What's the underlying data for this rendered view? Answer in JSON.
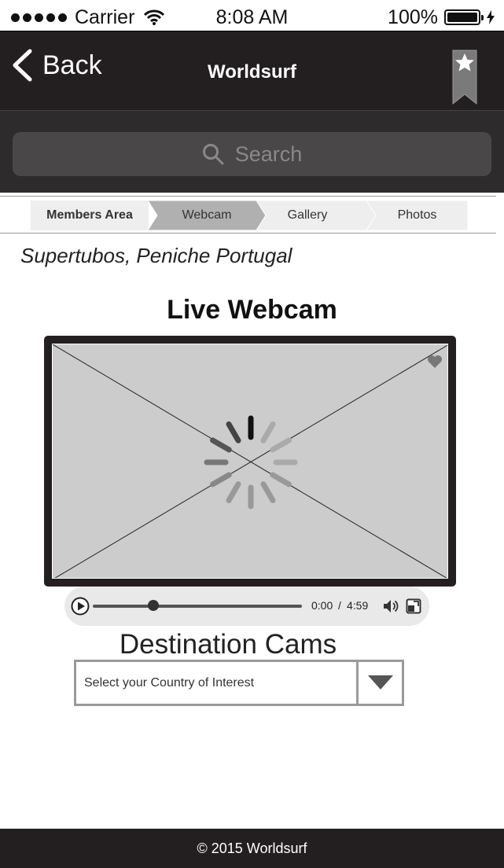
{
  "status_bar": {
    "carrier": "Carrier",
    "time": "8:08 AM",
    "battery": "100%"
  },
  "header": {
    "back_label": "Back",
    "title": "Worldsurf"
  },
  "search": {
    "placeholder": "Search"
  },
  "tabs": [
    {
      "label": "Members Area",
      "active": false
    },
    {
      "label": "Webcam",
      "active": true
    },
    {
      "label": "Gallery",
      "active": false
    },
    {
      "label": "Photos",
      "active": false
    }
  ],
  "location": "Supertubos, Peniche Portugal",
  "webcam": {
    "title": "Live Webcam"
  },
  "player": {
    "current_time": "0:00",
    "separator": "/",
    "duration": "4:59",
    "progress": 0.29
  },
  "destinations": {
    "title": "Destination Cams",
    "select_value": "Select your Country of Interest"
  },
  "footer": {
    "copyright": "© 2015 Worldsurf"
  },
  "colors": {
    "dark": "#231f20",
    "search_bg": "#2e2b2c",
    "search_field": "#4a4748",
    "video_bg": "#cccccc",
    "active_tab": "#b0b0b0",
    "tab_bg": "#eeeeee"
  },
  "icons": [
    "signal-dots-icon",
    "wifi-icon",
    "battery-icon",
    "charging-bolt-icon",
    "back-chevron-icon",
    "bookmark-star-icon",
    "search-icon",
    "heart-icon",
    "loading-spinner-icon",
    "play-icon",
    "volume-icon",
    "fullscreen-icon",
    "dropdown-arrow-icon"
  ]
}
